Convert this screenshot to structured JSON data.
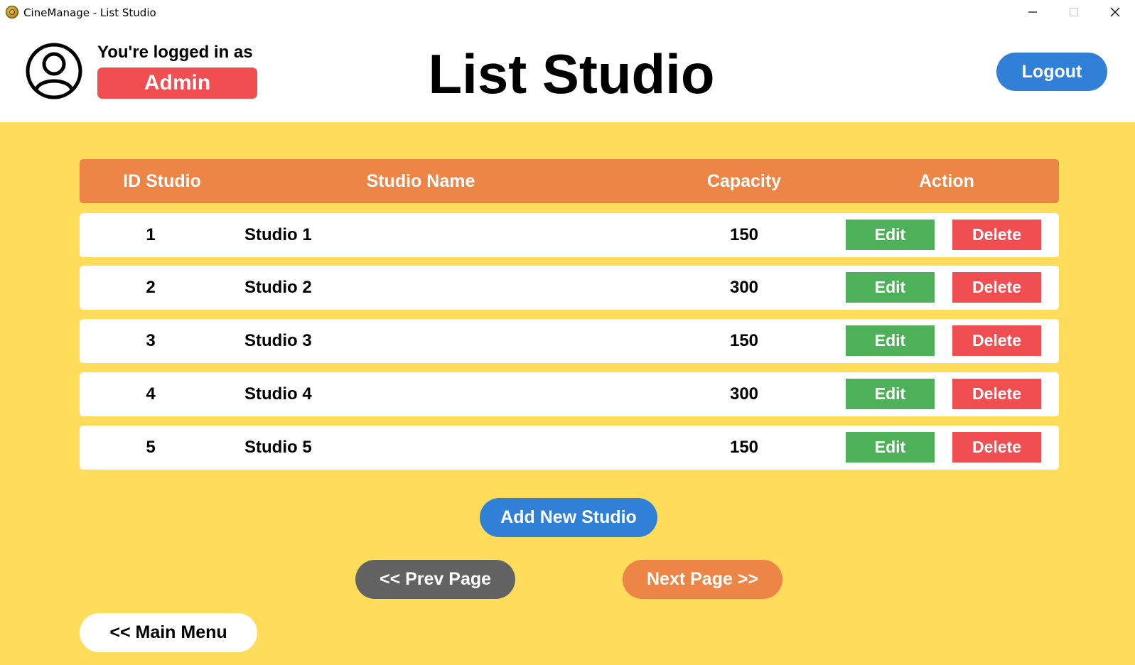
{
  "window": {
    "title": "CineManage - List Studio"
  },
  "header": {
    "logged_in_label": "You're logged in as",
    "role": "Admin",
    "page_title": "List Studio",
    "logout_label": "Logout"
  },
  "table": {
    "columns": [
      "ID Studio",
      "Studio Name",
      "Capacity",
      "Action"
    ],
    "rows": [
      {
        "id": "1",
        "name": "Studio 1",
        "capacity": "150"
      },
      {
        "id": "2",
        "name": "Studio 2",
        "capacity": "300"
      },
      {
        "id": "3",
        "name": "Studio 3",
        "capacity": "150"
      },
      {
        "id": "4",
        "name": "Studio 4",
        "capacity": "300"
      },
      {
        "id": "5",
        "name": "Studio 5",
        "capacity": "150"
      }
    ],
    "edit_label": "Edit",
    "delete_label": "Delete"
  },
  "actions": {
    "add_label": "Add New Studio",
    "prev_label": "<< Prev Page",
    "next_label": "Next Page >>",
    "main_menu_label": "<< Main Menu"
  },
  "colors": {
    "background": "#ffdc5a",
    "header_orange": "#ec8546",
    "primary_blue": "#2f80d6",
    "danger_red": "#f04e51",
    "success_green": "#4eb059",
    "neutral_gray": "#626262"
  },
  "icons": {
    "app": "app-reel-icon",
    "avatar": "user-avatar-icon"
  }
}
